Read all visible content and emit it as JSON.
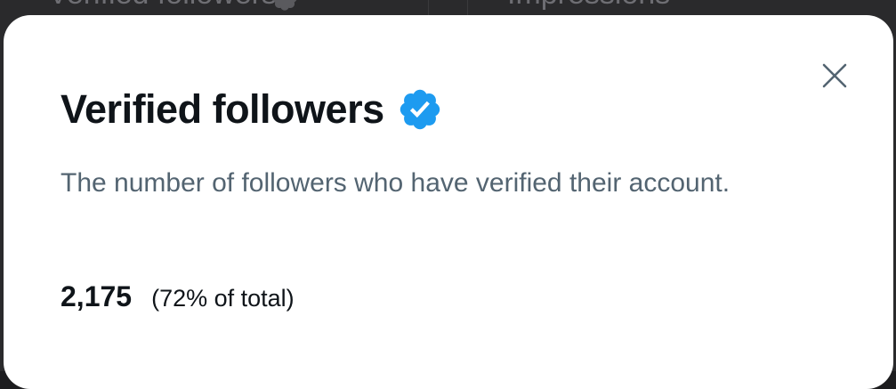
{
  "background": {
    "left_tab_label": "Verified followers",
    "right_tab_label": "Impressions"
  },
  "modal": {
    "title": "Verified followers",
    "description": "The number of followers who have verified their account.",
    "count": "2,175",
    "percent_text": "(72% of total)"
  },
  "icons": {
    "verified": "verified-badge-icon",
    "close": "close-icon"
  },
  "colors": {
    "verified_blue": "#1d9bf0",
    "title_text": "#0f1419",
    "secondary_text": "#536471",
    "close_icon": "#536471"
  }
}
